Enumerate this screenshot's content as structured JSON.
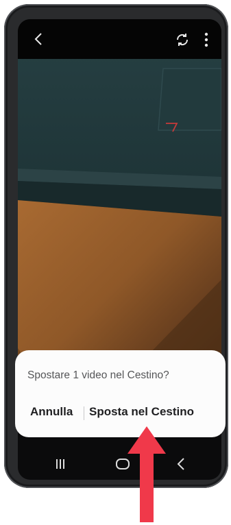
{
  "top_bar": {
    "back_icon": "chevron-left-icon",
    "rotate_icon": "rotate-icon",
    "more_icon": "more-vertical-icon"
  },
  "dialog": {
    "title": "Spostare 1 video nel Cestino?",
    "cancel_label": "Annulla",
    "confirm_label": "Sposta nel Cestino"
  },
  "nav_bar": {
    "recents_icon": "recents-icon",
    "home_icon": "home-icon",
    "back_icon": "back-icon"
  },
  "colors": {
    "dialog_background": "#fcfcfc",
    "annotation_arrow": "#f0394a"
  }
}
